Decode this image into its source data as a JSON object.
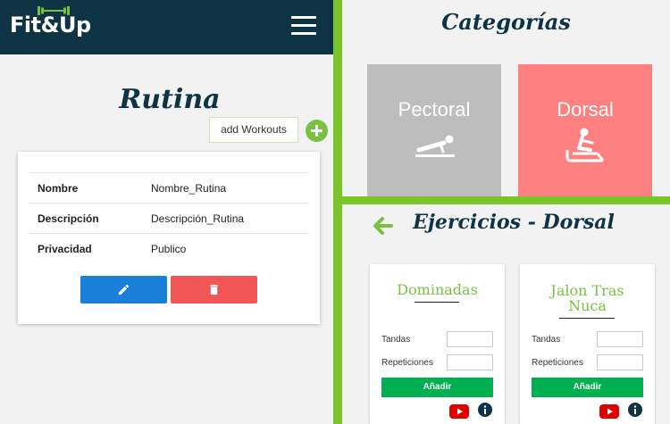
{
  "header": {
    "logo_text": "Fit&Up",
    "logo_icon": "dumbbell-icon",
    "menu_icon": "hamburger-icon"
  },
  "rutina": {
    "title": "Rutina",
    "add_tooltip": "add Workouts",
    "rows": [
      {
        "key": "Nombre",
        "value": "Nombre_Rutina"
      },
      {
        "key": "Descripción",
        "value": "Descripción_Rutina"
      },
      {
        "key": "Privacidad",
        "value": "Publico"
      }
    ],
    "edit_icon": "pencil-icon",
    "delete_icon": "trash-icon"
  },
  "categorias": {
    "title": "Categorías",
    "tiles": [
      {
        "label": "Pectoral",
        "icon": "pushup-icon",
        "color": "#bdbdbd"
      },
      {
        "label": "Dorsal",
        "icon": "rowing-icon",
        "color": "#ff8080"
      }
    ]
  },
  "ejercicios": {
    "title": "Ejercicios - Dorsal",
    "cards": [
      {
        "name": "Dominadas",
        "tandas_label": "Tandas",
        "reps_label": "Repeticiones",
        "button": "Añadir"
      },
      {
        "name": "Jalon Tras Nuca",
        "tandas_label": "Tandas",
        "reps_label": "Repeticiones",
        "button": "Añadir"
      }
    ]
  },
  "colors": {
    "navy": "#0d3344",
    "green": "#7ac52a",
    "blue": "#1a7fd8",
    "red": "#f25555",
    "button_green": "#00b050"
  }
}
